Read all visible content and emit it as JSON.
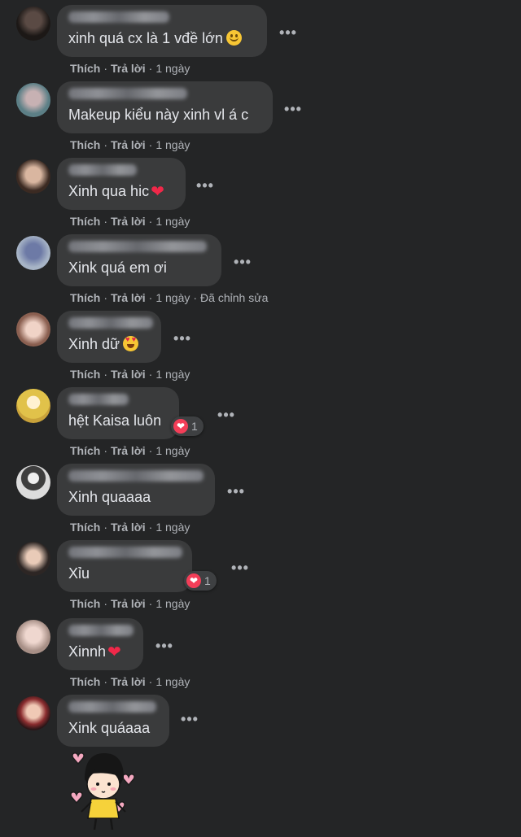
{
  "labels": {
    "like": "Thích",
    "reply": "Trả lời",
    "sep": "·",
    "more": "•••"
  },
  "comments": [
    {
      "text": "xinh quá cx là 1 vđề lớn",
      "emoji": "smile-emoji",
      "time": "1 ngày",
      "edited": ""
    },
    {
      "text": "Makeup kiểu này xinh vl á c",
      "emoji": "",
      "time": "1 ngày",
      "edited": ""
    },
    {
      "text": "Xinh qua hic",
      "emoji": "red-heart",
      "time": "1 ngày",
      "edited": ""
    },
    {
      "text": "Xink quá em ơi",
      "emoji": "",
      "time": "1 ngày",
      "edited": "Đã chỉnh sửa"
    },
    {
      "text": "Xinh dữ",
      "emoji": "heart-eyes-emoji",
      "time": "1 ngày",
      "edited": ""
    },
    {
      "text": "hệt Kaisa luôn",
      "emoji": "",
      "time": "1 ngày",
      "edited": "",
      "reaction_count": "1"
    },
    {
      "text": "Xinh quaaaa",
      "emoji": "",
      "time": "1 ngày",
      "edited": ""
    },
    {
      "text": "Xỉu",
      "emoji": "",
      "time": "1 ngày",
      "edited": "",
      "reaction_count": "1"
    },
    {
      "text": "Xinnh",
      "emoji": "red-heart",
      "time": "1 ngày",
      "edited": ""
    },
    {
      "text": "Xink quáaaa",
      "emoji": "",
      "time": "",
      "edited": ""
    }
  ],
  "glyphs": {
    "heart": "❤"
  },
  "colors": {
    "background": "#242526",
    "bubble": "#3a3b3c",
    "text": "#e4e6eb",
    "muted": "#b0b3b8",
    "love": "#f33e58"
  }
}
